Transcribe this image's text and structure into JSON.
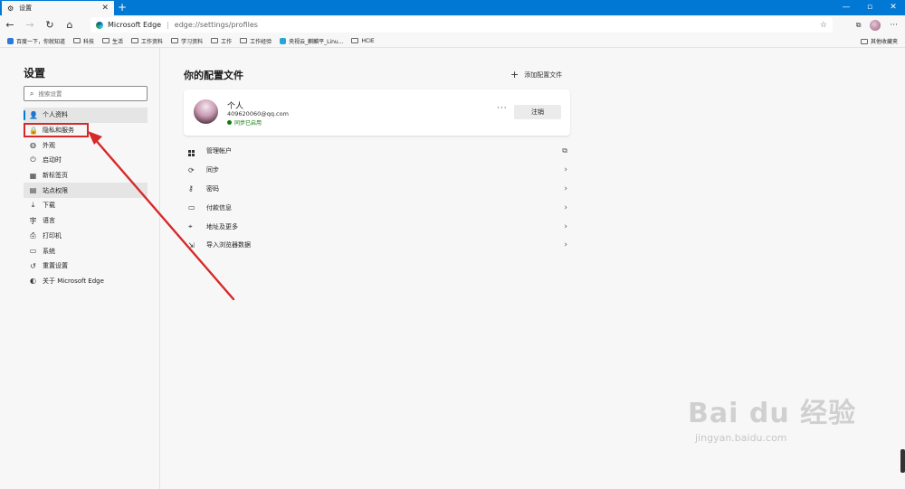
{
  "browser": {
    "tab_title": "设置",
    "tab_close": "✕",
    "new_tab": "+",
    "window_controls": [
      "—",
      "▫",
      "✕"
    ],
    "omnibox_site": "Microsoft Edge",
    "omnibox_separator": "|",
    "omnibox_url": "edge://settings/profiles"
  },
  "favorites": {
    "items": [
      {
        "label": "百度一下，你就知道",
        "icon": "paw-icon"
      },
      {
        "label": "科技",
        "icon": "folder-icon"
      },
      {
        "label": "生活",
        "icon": "folder-icon"
      },
      {
        "label": "工作资料",
        "icon": "folder-icon"
      },
      {
        "label": "学习资料",
        "icon": "folder-icon"
      },
      {
        "label": "工作",
        "icon": "folder-icon"
      },
      {
        "label": "工作经验",
        "icon": "folder-icon"
      },
      {
        "label": "央视云_麒麟平_Linu...",
        "icon": "cloud-icon"
      },
      {
        "label": "HCIE",
        "icon": "folder-icon"
      }
    ],
    "other_label": "其他收藏夹"
  },
  "sidebar": {
    "title": "设置",
    "search_placeholder": "搜索设置",
    "items": [
      {
        "label": "个人资料",
        "icon": "person-icon",
        "glyph": "👤"
      },
      {
        "label": "隐私和服务",
        "icon": "lock-icon",
        "glyph": "🔒"
      },
      {
        "label": "外观",
        "icon": "palette-icon",
        "glyph": "◍"
      },
      {
        "label": "启动时",
        "icon": "power-icon",
        "glyph": "⏻"
      },
      {
        "label": "新标签页",
        "icon": "newtab-icon",
        "glyph": "▦"
      },
      {
        "label": "站点权限",
        "icon": "site-permissions-icon",
        "glyph": "▤"
      },
      {
        "label": "下载",
        "icon": "download-icon",
        "glyph": "⤓"
      },
      {
        "label": "语言",
        "icon": "language-icon",
        "glyph": "字"
      },
      {
        "label": "打印机",
        "icon": "printer-icon",
        "glyph": "⎙"
      },
      {
        "label": "系统",
        "icon": "system-icon",
        "glyph": "▭"
      },
      {
        "label": "重置设置",
        "icon": "reset-icon",
        "glyph": "↺"
      },
      {
        "label": "关于 Microsoft Edge",
        "icon": "edge-logo-icon",
        "glyph": "◐"
      }
    ]
  },
  "main": {
    "title": "你的配置文件",
    "add_profile_label": "添加配置文件",
    "profile": {
      "name": "个人",
      "email": "409620060@qq.com",
      "sync_status": "同步已启用",
      "more": "···",
      "signout_label": "注销"
    },
    "menu": [
      {
        "label": "管理帐户",
        "icon": "manage-account-icon",
        "trail": "⧉"
      },
      {
        "label": "同步",
        "icon": "sync-icon",
        "trail": "›"
      },
      {
        "label": "密码",
        "icon": "key-icon",
        "trail": "›"
      },
      {
        "label": "付款信息",
        "icon": "card-icon",
        "trail": "›"
      },
      {
        "label": "地址及更多",
        "icon": "location-icon",
        "trail": "›"
      },
      {
        "label": "导入浏览器数据",
        "icon": "import-icon",
        "trail": "›"
      }
    ]
  },
  "watermark": {
    "main": "Bai du 经验",
    "sub": "jingyan.baidu.com"
  },
  "colors": {
    "accent": "#0078d4",
    "annotation_red": "#d62a2a",
    "sync_green": "#107c10"
  }
}
